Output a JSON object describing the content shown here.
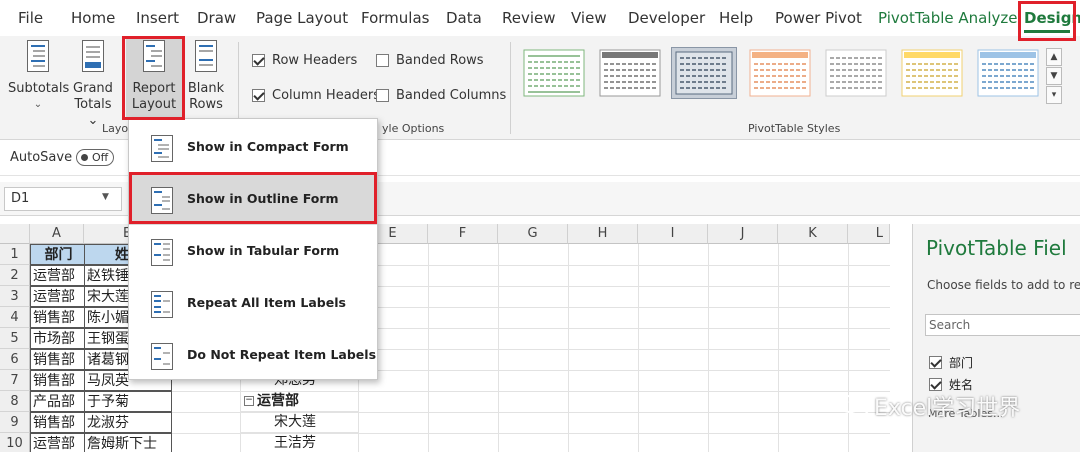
{
  "tabs": [
    {
      "label": "File"
    },
    {
      "label": "Home"
    },
    {
      "label": "Insert"
    },
    {
      "label": "Draw"
    },
    {
      "label": "Page Layout"
    },
    {
      "label": "Formulas"
    },
    {
      "label": "Data"
    },
    {
      "label": "Review"
    },
    {
      "label": "View"
    },
    {
      "label": "Developer"
    },
    {
      "label": "Help"
    },
    {
      "label": "Power Pivot"
    },
    {
      "label": "PivotTable Analyze"
    },
    {
      "label": "Design"
    }
  ],
  "ribbon": {
    "subtotals": {
      "line1": "Subtotals",
      "line2": "⌄"
    },
    "grand_totals": {
      "line1": "Grand",
      "line2": "Totals ⌄"
    },
    "report_layout": {
      "line1": "Report",
      "line2": "Layout ⌄"
    },
    "blank_rows": {
      "line1": "Blank",
      "line2": "Rows ⌄"
    },
    "layout_group_label": "Layo",
    "options": {
      "row_headers": "Row Headers",
      "column_headers": "Column Headers",
      "banded_rows": "Banded Rows",
      "banded_columns": "Banded Columns"
    },
    "style_options_label": "yle Options",
    "pivot_styles_label": "PivotTable Styles"
  },
  "autosave": {
    "label": "AutoSave",
    "state": "Off"
  },
  "namebox": {
    "value": "D1"
  },
  "grid": {
    "columns": [
      "A",
      "B",
      "E",
      "F",
      "G",
      "H",
      "I",
      "J",
      "K",
      "L"
    ],
    "rows": [
      "1",
      "2",
      "3",
      "4",
      "5",
      "6",
      "7",
      "8",
      "9",
      "10"
    ],
    "col_a": [
      "部门",
      "运营部",
      "运营部",
      "销售部",
      "市场部",
      "销售部",
      "销售部",
      "产品部",
      "销售部",
      "运营部"
    ],
    "col_b": [
      "姓",
      "赵铁锤",
      "宋大莲",
      "陈小媚",
      "王钢蛋",
      "诸葛钢",
      "马凤英",
      "于予菊",
      "龙淑芬",
      "詹姆斯下士"
    ],
    "pivot_cells": [
      "郑悠男",
      "运营部",
      "宋大莲",
      "王洁芳"
    ]
  },
  "menu": {
    "items": [
      {
        "label": "Show in Compact Form"
      },
      {
        "label": "Show in Outline Form"
      },
      {
        "label": "Show in Tabular Form"
      },
      {
        "label": "Repeat All Item Labels"
      },
      {
        "label": "Do Not Repeat Item Labels"
      }
    ]
  },
  "pivot_panel": {
    "title": "PivotTable Fiel",
    "subtitle": "Choose fields to add to rep",
    "search_placeholder": "Search",
    "fields": [
      {
        "label": "部门",
        "checked": true
      },
      {
        "label": "姓名",
        "checked": true
      }
    ],
    "more": "More Tables..."
  },
  "watermark": {
    "text": "Excel学习世界"
  },
  "colors": {
    "accent_green": "#1f7a3d",
    "highlight_red": "#e0202a",
    "header_blue": "#bdd7ee"
  }
}
